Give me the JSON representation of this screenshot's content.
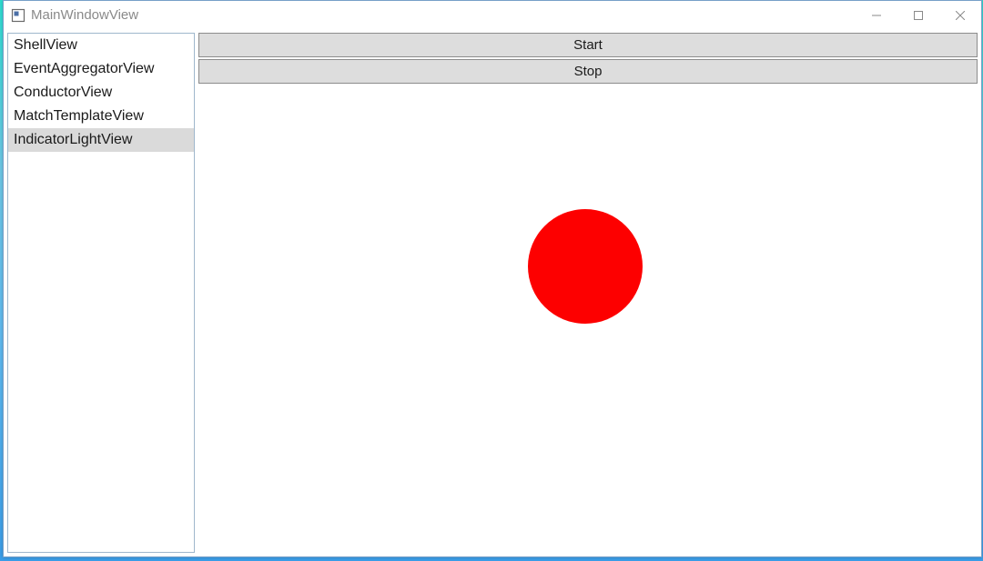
{
  "window": {
    "title": "MainWindowView"
  },
  "sidebar": {
    "items": [
      {
        "label": "ShellView",
        "selected": false
      },
      {
        "label": "EventAggregatorView",
        "selected": false
      },
      {
        "label": "ConductorView",
        "selected": false
      },
      {
        "label": "MatchTemplateView",
        "selected": false
      },
      {
        "label": "IndicatorLightView",
        "selected": true
      }
    ]
  },
  "main": {
    "buttons": {
      "start": "Start",
      "stop": "Stop"
    },
    "indicator": {
      "color": "#fd0000"
    }
  }
}
